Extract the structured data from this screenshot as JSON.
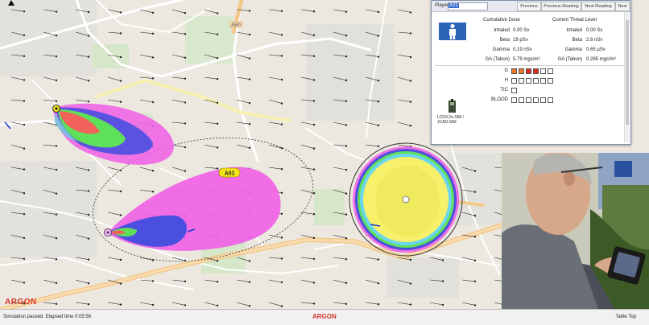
{
  "window_brand": "ARGON",
  "map": {
    "marker_label": "A01",
    "road_label": "A580"
  },
  "player_panel": {
    "player_label": "Player",
    "player_value": "A01",
    "buttons": [
      "Previous",
      "Previous Reading",
      "Next Reading",
      "Next"
    ],
    "cumulative_header": "Cumulative  Dose",
    "current_header": "Current Threat  Level",
    "rows": [
      {
        "label": "Inhaled",
        "cumulative": "0.00 Sv",
        "current": "0.00 Sv"
      },
      {
        "label": "Beta",
        "cumulative": "19 pSv",
        "current": "2.8 nSv"
      },
      {
        "label": "Gamma",
        "cumulative": "0.19 nSv",
        "current": "0.65 µSv"
      },
      {
        "label": "GA (Tabun)",
        "cumulative": "5.79 mgs/m³",
        "current": "0.285 mgs/m³"
      }
    ],
    "indicators": [
      {
        "label": "G",
        "bars": [
          "orange",
          "orange",
          "red",
          "red",
          "empty",
          "empty"
        ]
      },
      {
        "label": "H",
        "bars": [
          "empty",
          "empty",
          "empty",
          "empty",
          "empty",
          "empty"
        ]
      },
      {
        "label": "TIC",
        "bars": [
          "empty"
        ]
      },
      {
        "label": "BLOOD",
        "bars": [
          "empty",
          "empty",
          "empty",
          "empty",
          "empty",
          "empty"
        ]
      }
    ],
    "device_label_1": "LCD3.2e-SIM /",
    "device_label_2": "JCAD-SIM"
  },
  "status_bar": {
    "left": "Simulation paused. Elapsed time 0:05:56",
    "brand": "ARGON",
    "right": "Table Top"
  },
  "colors": {
    "plume_magenta": "#f062e6",
    "plume_blue": "#4a4fe0",
    "plume_green": "#5fe05a",
    "plume_red": "#f0625a",
    "radiation_yellow": "#f6f06a",
    "brand_red": "#d4342a",
    "indicator_orange": "#f07828",
    "indicator_red": "#e02a1c"
  }
}
